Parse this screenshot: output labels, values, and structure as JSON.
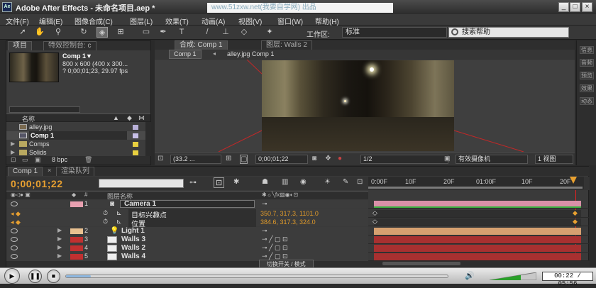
{
  "window": {
    "app_logo": "Ae",
    "title": "Adobe After Effects - 未命名项目.aep *",
    "watermark": "www.51zxw.net(我要自学网) 出品",
    "buttons": [
      "_",
      "□",
      "×"
    ]
  },
  "menu": [
    "文件(F)",
    "编辑(E)",
    "图像合成(C)",
    "图层(L)",
    "效果(T)",
    "动画(A)",
    "视图(V)",
    "窗口(W)",
    "帮助(H)"
  ],
  "toolbar": {
    "workspace_label": "工作区:",
    "workspace_value": "标准",
    "search_placeholder": "搜索帮助"
  },
  "project": {
    "tabs": [
      "项目",
      "特效控制台: c"
    ],
    "comp_name": "Comp 1▼",
    "comp_info1": "800 x 600 (400 x 300...",
    "comp_info2": "? 0;00;01;23, 29.97 fps",
    "col_name": "名称",
    "items": [
      {
        "name": "alley.jpg",
        "kind": "image",
        "label": "#b8b0d8",
        "selected": false
      },
      {
        "name": "Comp 1",
        "kind": "comp",
        "label": "#c8c0e8",
        "selected": true
      },
      {
        "name": "Comps",
        "kind": "folder",
        "label": "#e8d040",
        "selected": false
      },
      {
        "name": "Solids",
        "kind": "folder",
        "label": "#e8d040",
        "selected": false
      }
    ],
    "bpc": "8 bpc"
  },
  "composition": {
    "tab1": "合成: Comp 1",
    "tab2": "图层: Walls 2",
    "breadcrumb_active": "Comp 1",
    "breadcrumb_next": "alley.jpg Comp 1",
    "zoom": "(33.2 ...",
    "timecode": "0;00;01;22",
    "resolution": "1/2",
    "camera": "有效摄像机",
    "views": "1 视图"
  },
  "right_strip": [
    "信息",
    "音频",
    "预览",
    "效果",
    "动态"
  ],
  "timeline": {
    "tabs": [
      "Comp 1",
      "渲染队列"
    ],
    "current_time": "0;00;01;22",
    "ruler": [
      "0:00F",
      "10F",
      "20F",
      "01:00F",
      "10F",
      "20F"
    ],
    "col_label": "图层名称",
    "layers": [
      {
        "num": "1",
        "name": "Camera 1",
        "color": "#e8a0b0",
        "type": "camera",
        "bar": "#d890a8"
      },
      {
        "num": "",
        "name": "目标兴趣点",
        "prop": true,
        "value": "350.7, 317.3, 1101.0"
      },
      {
        "num": "",
        "name": "位置",
        "prop": true,
        "value": "384.6, 317.3, 324.0"
      },
      {
        "num": "2",
        "name": "Light 1",
        "color": "#e8c090",
        "type": "light",
        "bar": "#d6a070"
      },
      {
        "num": "3",
        "name": "Walls 3",
        "color": "#c03030",
        "type": "solid",
        "bar": "#a83030"
      },
      {
        "num": "4",
        "name": "Walls 2",
        "color": "#c03030",
        "type": "solid",
        "bar": "#a83030"
      },
      {
        "num": "5",
        "name": "Walls 4",
        "color": "#c03030",
        "type": "solid",
        "bar": "#a83030"
      }
    ],
    "switch_toggle": "切换开关 / 模式"
  },
  "player": {
    "time": "00:22 / 05:56",
    "progress": 0.065
  }
}
